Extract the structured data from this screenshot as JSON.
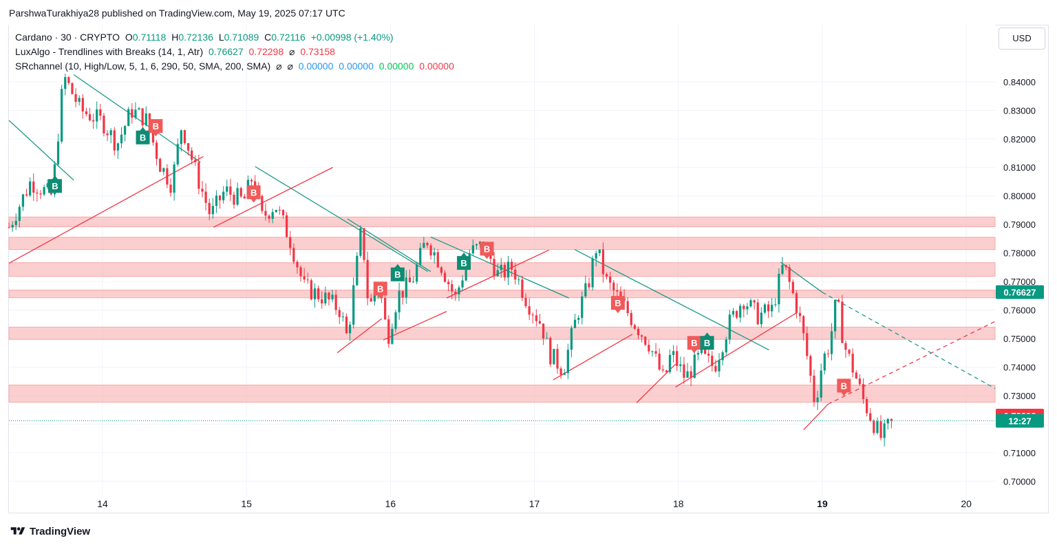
{
  "header": {
    "published": "ParshwaTurakhiya28 published on TradingView.com, May 19, 2025 07:17 UTC"
  },
  "legend": {
    "symbol": "Cardano · 30 · CRYPTO",
    "o_label": "O",
    "o_value": "0.71118",
    "h_label": "H",
    "h_value": "0.72136",
    "l_label": "L",
    "l_value": "0.71089",
    "c_label": "C",
    "c_value": "0.72116",
    "change": "+0.00998 (+1.40%)",
    "lux_name": "LuxAlgo - Trendlines with Breaks (14, 1, Atr)",
    "lux_v1": "0.76627",
    "lux_v2": "0.72298",
    "lux_v3": "⌀",
    "lux_v4": "0.73158",
    "sr_name": "SRchannel (10, High/Low, 5, 1, 6, 290, 50, SMA, 200, SMA)",
    "sr_sym1": "⌀",
    "sr_sym2": "⌀",
    "sr_v1": "0.00000",
    "sr_v2": "0.00000",
    "sr_v3": "0.00000",
    "sr_v4": "0.00000"
  },
  "currency": "USD",
  "footer": {
    "brand": "TradingView"
  },
  "colors": {
    "up": "#089981",
    "down": "#f23645",
    "zone": "#f8a7a7",
    "teal_line": "#1a9b87",
    "red_line": "#f23645"
  },
  "chart_data": {
    "type": "candlestick",
    "symbol": "Cardano",
    "interval": "30",
    "ylim": [
      0.695,
      0.846
    ],
    "y_ticks": [
      "0.84000",
      "0.83000",
      "0.82000",
      "0.81000",
      "0.80000",
      "0.79000",
      "0.78000",
      "0.77000",
      "0.76000",
      "0.75000",
      "0.74000",
      "0.73000",
      "0.72000",
      "0.71000",
      "0.70000"
    ],
    "x_ticks": [
      {
        "label": "14",
        "t": 6.5
      },
      {
        "label": "15",
        "t": 16.5
      },
      {
        "label": "16",
        "t": 26.5
      },
      {
        "label": "17",
        "t": 36.5
      },
      {
        "label": "18",
        "t": 46.5
      },
      {
        "label": "19",
        "t": 56.5
      },
      {
        "label": "20",
        "t": 66.5
      }
    ],
    "x_range": [
      0,
      68.5
    ],
    "price_labels": [
      {
        "value": 0.76627,
        "text": "0.76627",
        "color": "#089981"
      },
      {
        "value": 0.72298,
        "text": "0.72298",
        "color": "#f23645"
      },
      {
        "value": 0.72116,
        "text": "12:27",
        "color": "#089981"
      }
    ],
    "current_price": 0.72116,
    "candles_path": [
      [
        0,
        0.789
      ],
      [
        1.5,
        0.805
      ],
      [
        3,
        0.8
      ],
      [
        3.8,
        0.842
      ],
      [
        5,
        0.83
      ],
      [
        6.5,
        0.826
      ],
      [
        7.5,
        0.818
      ],
      [
        8.5,
        0.83
      ],
      [
        9.5,
        0.827
      ],
      [
        10.5,
        0.811
      ],
      [
        11.3,
        0.804
      ],
      [
        12,
        0.825
      ],
      [
        13,
        0.808
      ],
      [
        14,
        0.793
      ],
      [
        15,
        0.802
      ],
      [
        16.3,
        0.798
      ],
      [
        17,
        0.808
      ],
      [
        17.5,
        0.792
      ],
      [
        18.5,
        0.797
      ],
      [
        19.5,
        0.785
      ],
      [
        20.5,
        0.768
      ],
      [
        22,
        0.764
      ],
      [
        23,
        0.76
      ],
      [
        23.5,
        0.75
      ],
      [
        24.5,
        0.789
      ],
      [
        25,
        0.76
      ],
      [
        25.7,
        0.77
      ],
      [
        26.3,
        0.75
      ],
      [
        27,
        0.765
      ],
      [
        28,
        0.77
      ],
      [
        29,
        0.785
      ],
      [
        30,
        0.776
      ],
      [
        31,
        0.764
      ],
      [
        32,
        0.78
      ],
      [
        33,
        0.783
      ],
      [
        34,
        0.772
      ],
      [
        35,
        0.775
      ],
      [
        36,
        0.763
      ],
      [
        37,
        0.755
      ],
      [
        37.5,
        0.745
      ],
      [
        38.5,
        0.739
      ],
      [
        39.5,
        0.759
      ],
      [
        40.2,
        0.768
      ],
      [
        40.8,
        0.782
      ],
      [
        41.5,
        0.77
      ],
      [
        42.5,
        0.763
      ],
      [
        43.5,
        0.755
      ],
      [
        44.5,
        0.748
      ],
      [
        45.5,
        0.735
      ],
      [
        46,
        0.745
      ],
      [
        47,
        0.736
      ],
      [
        48,
        0.744
      ],
      [
        49,
        0.74
      ],
      [
        50,
        0.755
      ],
      [
        51,
        0.764
      ],
      [
        52,
        0.758
      ],
      [
        53,
        0.76
      ],
      [
        53.8,
        0.776
      ],
      [
        54.8,
        0.76
      ],
      [
        55.3,
        0.748
      ],
      [
        56,
        0.727
      ],
      [
        56.5,
        0.742
      ],
      [
        57,
        0.748
      ],
      [
        57.5,
        0.764
      ],
      [
        58,
        0.748
      ],
      [
        58.8,
        0.737
      ],
      [
        59.3,
        0.729
      ],
      [
        60,
        0.721
      ],
      [
        60.6,
        0.715
      ],
      [
        61.3,
        0.721
      ]
    ],
    "zones": [
      {
        "low": 0.7892,
        "high": 0.7926
      },
      {
        "low": 0.7812,
        "high": 0.7855
      },
      {
        "low": 0.7718,
        "high": 0.7766
      },
      {
        "low": 0.7643,
        "high": 0.767
      },
      {
        "low": 0.7497,
        "high": 0.754
      },
      {
        "low": 0.7277,
        "high": 0.7337
      }
    ],
    "trendlines_down": [
      [
        [
          0,
          0.8265
        ],
        [
          4.5,
          0.8055
        ]
      ],
      [
        [
          4.5,
          0.8425
        ],
        [
          13.3,
          0.8118
        ]
      ],
      [
        [
          17.1,
          0.8103
        ],
        [
          29.1,
          0.7735
        ]
      ],
      [
        [
          23.5,
          0.792
        ],
        [
          29.3,
          0.7735
        ]
      ],
      [
        [
          29.3,
          0.7856
        ],
        [
          38.9,
          0.7642
        ]
      ],
      [
        [
          39.3,
          0.7812
        ],
        [
          52.8,
          0.746
        ]
      ],
      [
        [
          53.6,
          0.7768
        ],
        [
          56.5,
          0.7662
        ]
      ]
    ],
    "trendlines_down_dashed": [
      [
        [
          56.5,
          0.7662
        ],
        [
          68.5,
          0.7325
        ]
      ]
    ],
    "trendlines_up": [
      [
        [
          0,
          0.7764
        ],
        [
          13.5,
          0.8138
        ]
      ],
      [
        [
          14.2,
          0.789
        ],
        [
          22.5,
          0.81
        ]
      ],
      [
        [
          22.8,
          0.745
        ],
        [
          25.9,
          0.757
        ]
      ],
      [
        [
          26,
          0.7495
        ],
        [
          30.4,
          0.7595
        ]
      ],
      [
        [
          30.4,
          0.7642
        ],
        [
          37.5,
          0.781
        ]
      ],
      [
        [
          37.8,
          0.7355
        ],
        [
          43.3,
          0.7515
        ]
      ],
      [
        [
          43.6,
          0.7275
        ],
        [
          46.3,
          0.741
        ]
      ],
      [
        [
          46.3,
          0.733
        ],
        [
          54.7,
          0.759
        ]
      ],
      [
        [
          55.2,
          0.718
        ],
        [
          56.9,
          0.727
        ]
      ]
    ],
    "trendlines_up_dashed": [
      [
        [
          56.9,
          0.727
        ],
        [
          68.5,
          0.756
        ]
      ]
    ],
    "signals": [
      {
        "label": "B",
        "type": "bull",
        "t": 3.2,
        "price": 0.8035
      },
      {
        "label": "B",
        "type": "bull",
        "t": 9.3,
        "price": 0.8205
      },
      {
        "label": "B",
        "type": "bear",
        "t": 10.2,
        "price": 0.8245
      },
      {
        "label": "B",
        "type": "bear",
        "t": 17.0,
        "price": 0.8013
      },
      {
        "label": "B",
        "type": "bear",
        "t": 25.8,
        "price": 0.7675
      },
      {
        "label": "B",
        "type": "bull",
        "t": 27.0,
        "price": 0.7725
      },
      {
        "label": "B",
        "type": "bull",
        "t": 31.6,
        "price": 0.7765
      },
      {
        "label": "B",
        "type": "bear",
        "t": 33.2,
        "price": 0.7815
      },
      {
        "label": "B",
        "type": "bear",
        "t": 42.3,
        "price": 0.7625
      },
      {
        "label": "B",
        "type": "bear",
        "t": 47.6,
        "price": 0.7485
      },
      {
        "label": "B",
        "type": "bull",
        "t": 48.5,
        "price": 0.7485
      },
      {
        "label": "B",
        "type": "bear",
        "t": 58.0,
        "price": 0.7335
      }
    ]
  }
}
